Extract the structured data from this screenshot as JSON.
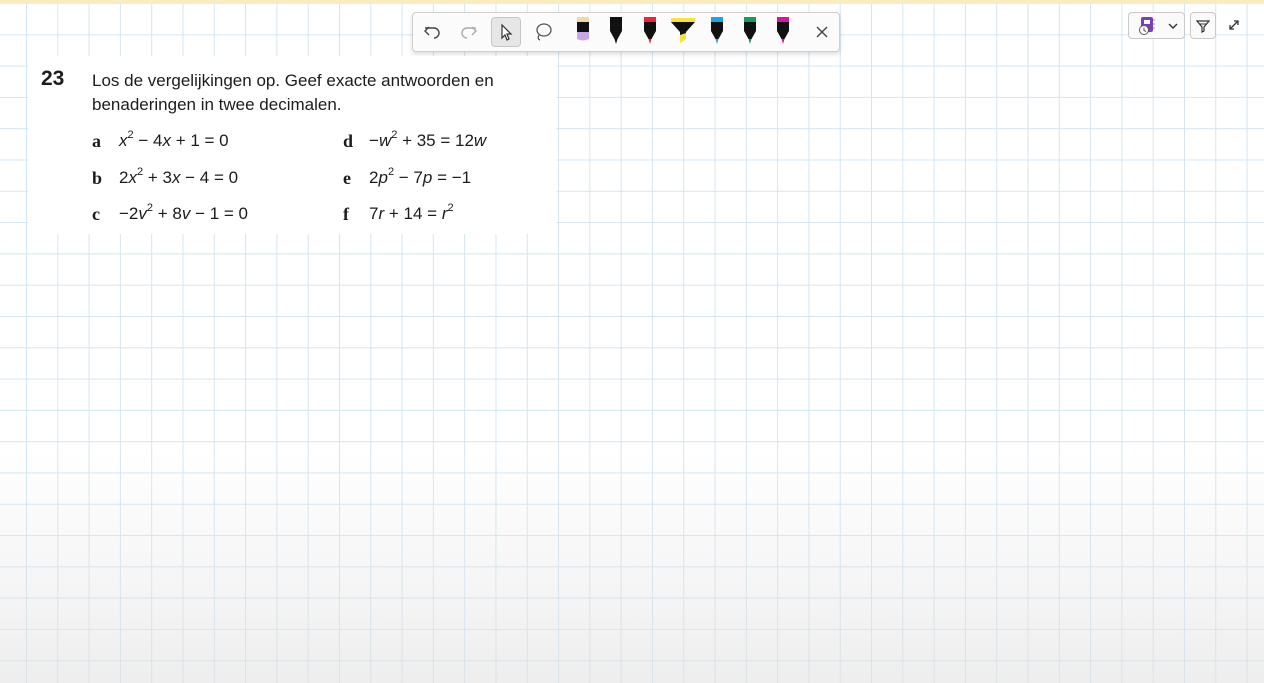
{
  "toolbar": {
    "tools": [
      {
        "name": "undo-icon"
      },
      {
        "name": "redo-icon"
      },
      {
        "name": "select-cursor-icon",
        "selected": true
      },
      {
        "name": "lasso-icon"
      }
    ],
    "pens": [
      {
        "name": "pen-lavender",
        "cap": "#f4d7a8",
        "tip": "#c9a7e6",
        "body": "#111111"
      },
      {
        "name": "pen-black",
        "cap": "#111111",
        "tip": "#111111",
        "body": "#111111"
      },
      {
        "name": "pen-red",
        "cap": "#e8283a",
        "tip": "#e8283a",
        "body": "#111111"
      },
      {
        "name": "highlighter-yellow",
        "cap": "#f5e33b",
        "tip": "#f5e33b",
        "body": "#111111"
      },
      {
        "name": "pen-blue",
        "cap": "#1fa3e0",
        "tip": "#1fa3e0",
        "body": "#111111"
      },
      {
        "name": "pen-green",
        "cap": "#1b9a5a",
        "tip": "#1b9a5a",
        "body": "#111111"
      },
      {
        "name": "pen-magenta",
        "cap": "#d8169a",
        "tip": "#d8169a",
        "body": "#111111"
      }
    ],
    "close_icon": "close-icon"
  },
  "controls": {
    "notebook_icon": "onenote-icon",
    "notebook_color": "#7b3fb5",
    "dropdown_icon": "chevron-down-icon",
    "filter_icon": "funnel-icon",
    "expand_icon": "expand-icon"
  },
  "exercise": {
    "number": "23",
    "instruction_line1": "Los de vergelijkingen op. Geef exacte antwoorden en",
    "instruction_line2": "benaderingen in twee decimalen.",
    "items": [
      {
        "letter": "a",
        "parts": [
          "x",
          "2",
          " − 4",
          "x",
          " + 1 = 0"
        ]
      },
      {
        "letter": "b",
        "parts": [
          "2",
          "x",
          "2",
          " + 3",
          "x",
          " − 4 = 0"
        ]
      },
      {
        "letter": "c",
        "parts": [
          "−2",
          "v",
          "2",
          " + 8",
          "v",
          " − 1 = 0"
        ]
      },
      {
        "letter": "d",
        "parts": [
          "−",
          "w",
          "2",
          " + 35 = 12",
          "w"
        ]
      },
      {
        "letter": "e",
        "parts": [
          "2",
          "p",
          "2",
          " − 7",
          "p",
          " = −1"
        ]
      },
      {
        "letter": "f",
        "parts": [
          "7",
          "r",
          " + 14 = ",
          "r",
          "2"
        ]
      }
    ]
  }
}
